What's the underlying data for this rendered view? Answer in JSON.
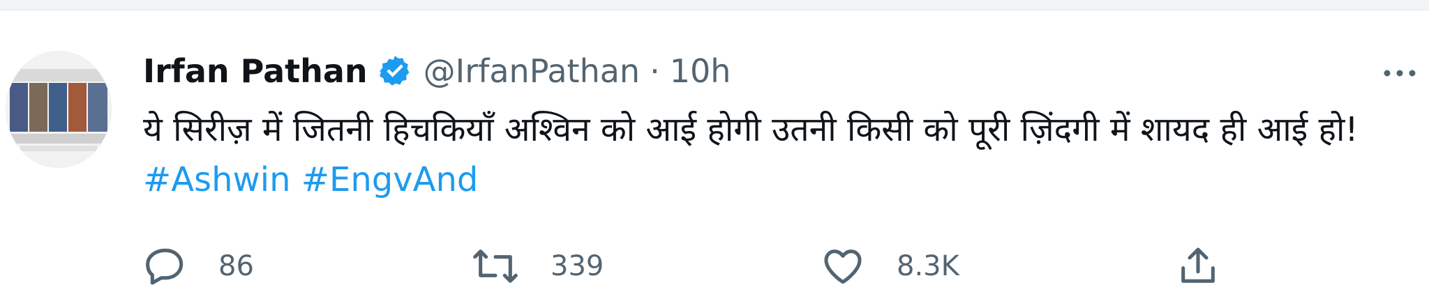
{
  "tweet": {
    "author_name": "Irfan Pathan",
    "handle": "@IrfanPathan",
    "separator": "·",
    "time": "10h",
    "text_main": "ये सिरीज़ में जितनी हिचकियाँ अश्विन को आई होगी उतनी किसी को पूरी ज़िंदगी में शायद ही आई हो!",
    "hashtags": [
      "#Ashwin",
      "#EngvAnd"
    ]
  },
  "actions": {
    "replies": "86",
    "retweets": "339",
    "likes": "8.3K"
  },
  "icons": {
    "verified": "verified-badge-icon",
    "more": "more-icon",
    "reply": "reply-icon",
    "retweet": "retweet-icon",
    "like": "heart-icon",
    "share": "share-icon"
  },
  "colors": {
    "accent": "#1d9bf0",
    "text": "#0f1419",
    "muted": "#536471"
  }
}
